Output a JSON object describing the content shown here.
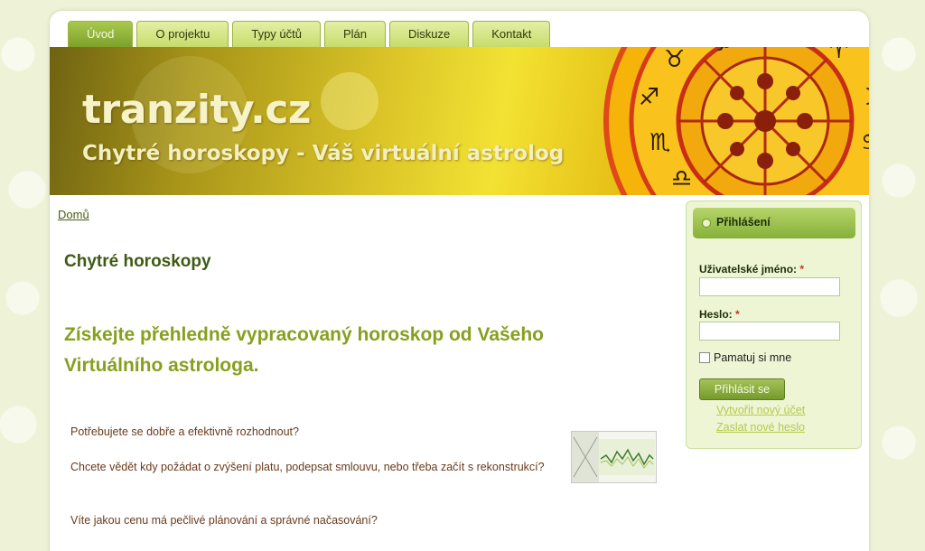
{
  "nav": {
    "tabs": [
      {
        "label": "Úvod"
      },
      {
        "label": "O projektu"
      },
      {
        "label": "Typy účtů"
      },
      {
        "label": "Plán"
      },
      {
        "label": "Diskuze"
      },
      {
        "label": "Kontakt"
      }
    ],
    "active_index": 0
  },
  "header": {
    "site_name": "tranzity.cz",
    "slogan": "Chytré horoskopy - Váš virtuální astrolog"
  },
  "breadcrumb": {
    "home": "Domů"
  },
  "main": {
    "title": "Chytré horoskopy",
    "lead": "Získejte přehledně vypracovaný horoskop od Vašeho Virtuálního astrologa.",
    "paragraphs": [
      "Potřebujete se dobře a efektivně rozhodnout?",
      "Chcete vědět kdy požádat o zvýšení platu, podepsat smlouvu, nebo třeba začít s rekonstrukcí?",
      "Víte jakou cenu má pečlivé plánování a správné načasování?"
    ]
  },
  "login": {
    "title": "Přihlášení",
    "username_label": "Uživatelské jméno:",
    "password_label": "Heslo:",
    "required_mark": "*",
    "username_value": "",
    "password_value": "",
    "remember_label": "Pamatuj si mne",
    "remember_checked": false,
    "submit_label": "Přihlásit se",
    "register_link": "Vytvořit nový účet",
    "reset_link": "Zaslat nové heslo"
  },
  "colors": {
    "accent_green": "#86a01e",
    "tab_active": "#7da12a",
    "background": "#eef3d8"
  }
}
